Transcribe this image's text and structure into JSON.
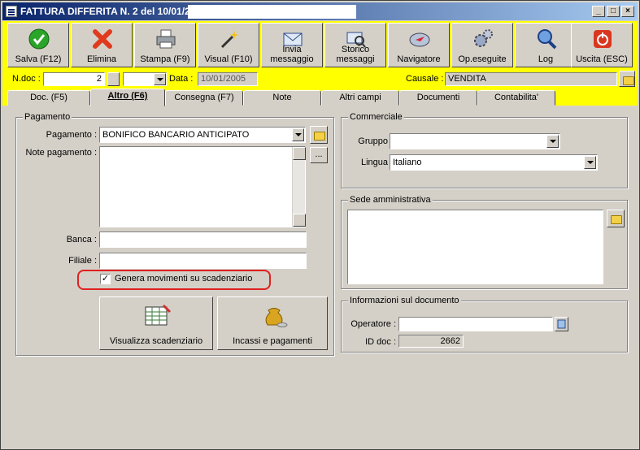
{
  "window": {
    "title": "FATTURA DIFFERITA N. 2  del 10/01/2",
    "controls": {
      "minimize": "_",
      "maximize": "□",
      "close": "×"
    }
  },
  "toolbar": [
    {
      "id": "save",
      "label": "Salva (F12)",
      "icon": "check-icon"
    },
    {
      "id": "delete",
      "label": "Elimina",
      "icon": "x-icon"
    },
    {
      "id": "print",
      "label": "Stampa (F9)",
      "icon": "printer-icon"
    },
    {
      "id": "visual",
      "label": "Visual (F10)",
      "icon": "magic-wand-icon"
    },
    {
      "id": "send",
      "label": "Invia\nmessaggio",
      "icon": "envelope-icon"
    },
    {
      "id": "history",
      "label": "Storico\nmessaggi",
      "icon": "magnifier-envelope-icon"
    },
    {
      "id": "navigator",
      "label": "Navigatore",
      "icon": "compass-icon"
    },
    {
      "id": "ops",
      "label": "Op.eseguite",
      "icon": "gears-icon"
    },
    {
      "id": "log",
      "label": "Log",
      "icon": "magnifier-icon"
    },
    {
      "id": "exit",
      "label": "Uscita (ESC)",
      "icon": "power-icon"
    }
  ],
  "info": {
    "ndoc_label": "N.doc :",
    "ndoc_value": "2",
    "data_label": "Data :",
    "data_value": "10/01/2005",
    "causale_label": "Causale :",
    "causale_value": "VENDITA"
  },
  "tabs": [
    {
      "label": "Doc. (F5)",
      "active": false
    },
    {
      "label": "Altro (F6)",
      "active": true
    },
    {
      "label": "Consegna (F7)",
      "active": false
    },
    {
      "label": "Note",
      "active": false
    },
    {
      "label": "Altri campi",
      "active": false
    },
    {
      "label": "Documenti",
      "active": false
    },
    {
      "label": "Contabilita'",
      "active": false
    }
  ],
  "pagamento": {
    "group_title": "Pagamento",
    "pagamento_label": "Pagamento :",
    "pagamento_value": "BONIFICO BANCARIO ANTICIPATO",
    "note_label": "Note pagamento :",
    "note_value": "",
    "ellipsis": "...",
    "banca_label": "Banca :",
    "banca_value": "",
    "filiale_label": "Filiale :",
    "filiale_value": "",
    "genera_label": "Genera movimenti su scadenziario",
    "genera_checked": true,
    "btn_scadenziario": "Visualizza scadenziario",
    "btn_incassi": "Incassi e pagamenti"
  },
  "commerciale": {
    "group_title": "Commerciale",
    "gruppo_label": "Gruppo",
    "gruppo_value": "",
    "lingua_label": "Lingua",
    "lingua_value": "Italiano"
  },
  "sede": {
    "group_title": "Sede amministrativa",
    "value": ""
  },
  "informazioni": {
    "group_title": "Informazioni sul documento",
    "operatore_label": "Operatore :",
    "operatore_value": "",
    "iddoc_label": "ID doc :",
    "iddoc_value": "2662"
  },
  "colors": {
    "accent_yellow": "#ffff00",
    "window_gray": "#d4d0c8",
    "highlight_red": "#e02020",
    "title_blue": "#0a246a"
  }
}
